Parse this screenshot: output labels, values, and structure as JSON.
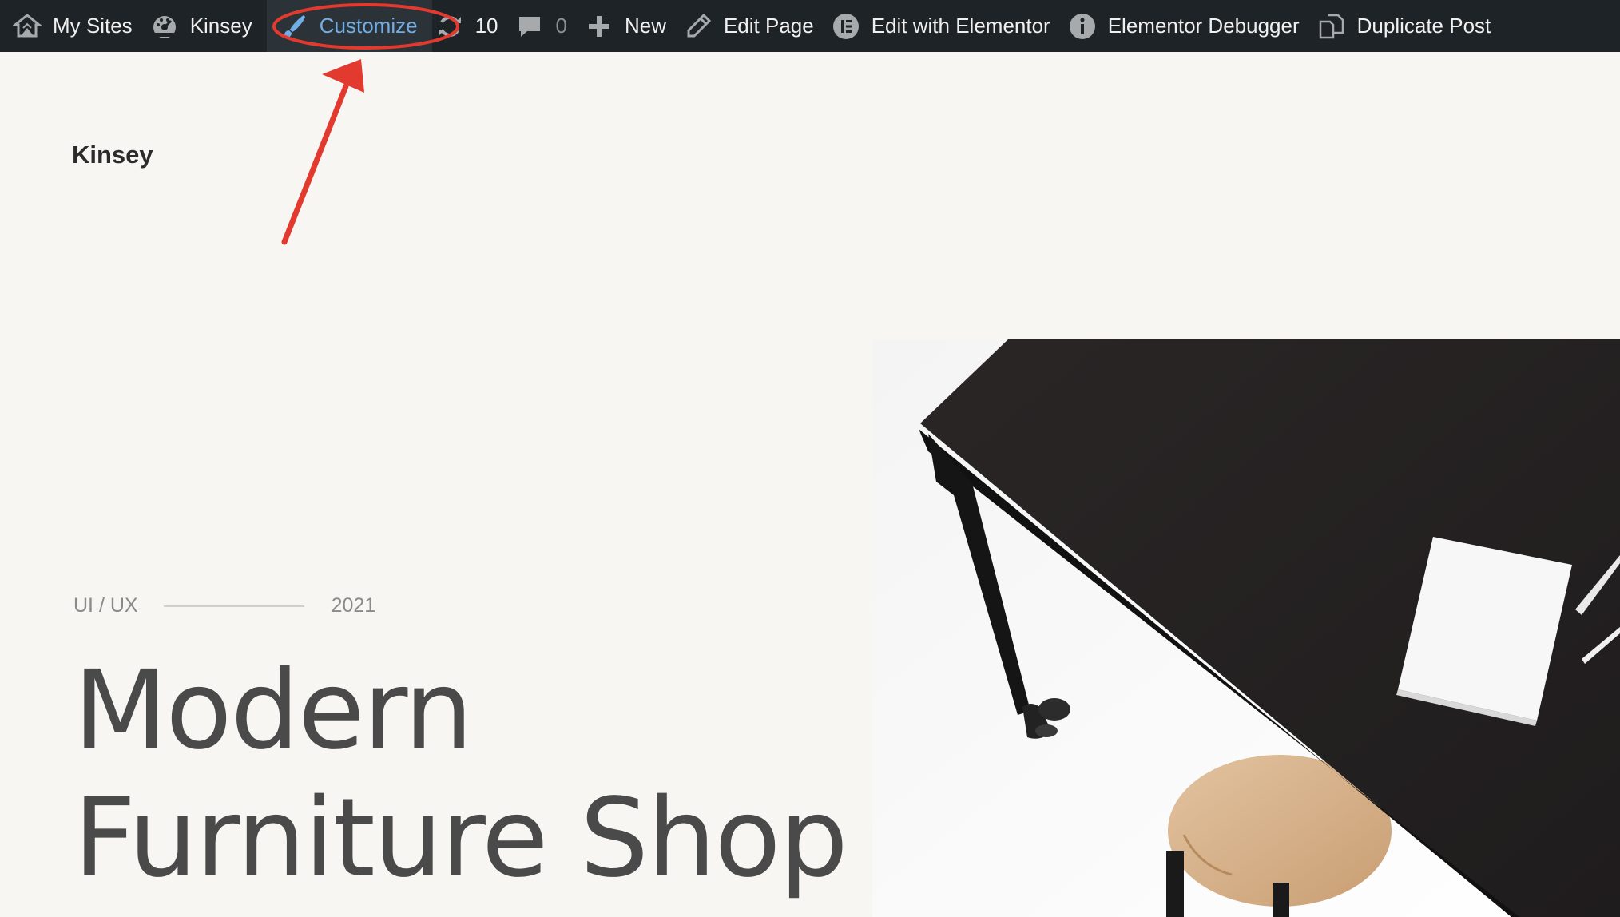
{
  "adminbar": {
    "my_sites": "My Sites",
    "site": "Kinsey",
    "customize": "Customize",
    "updates_count": "10",
    "comments_count": "0",
    "new": "New",
    "edit_page": "Edit Page",
    "edit_elementor": "Edit with Elementor",
    "debugger": "Elementor Debugger",
    "duplicate": "Duplicate Post"
  },
  "page": {
    "site_title": "Kinsey",
    "category": "UI / UX",
    "year": "2021",
    "hero_line1": "Modern",
    "hero_line2": "Furniture Shop"
  },
  "colors": {
    "adminbar_bg": "#1d2327",
    "active_link": "#72aee6",
    "annotation_red": "#e23a2f",
    "page_bg": "#f7f6f3"
  }
}
